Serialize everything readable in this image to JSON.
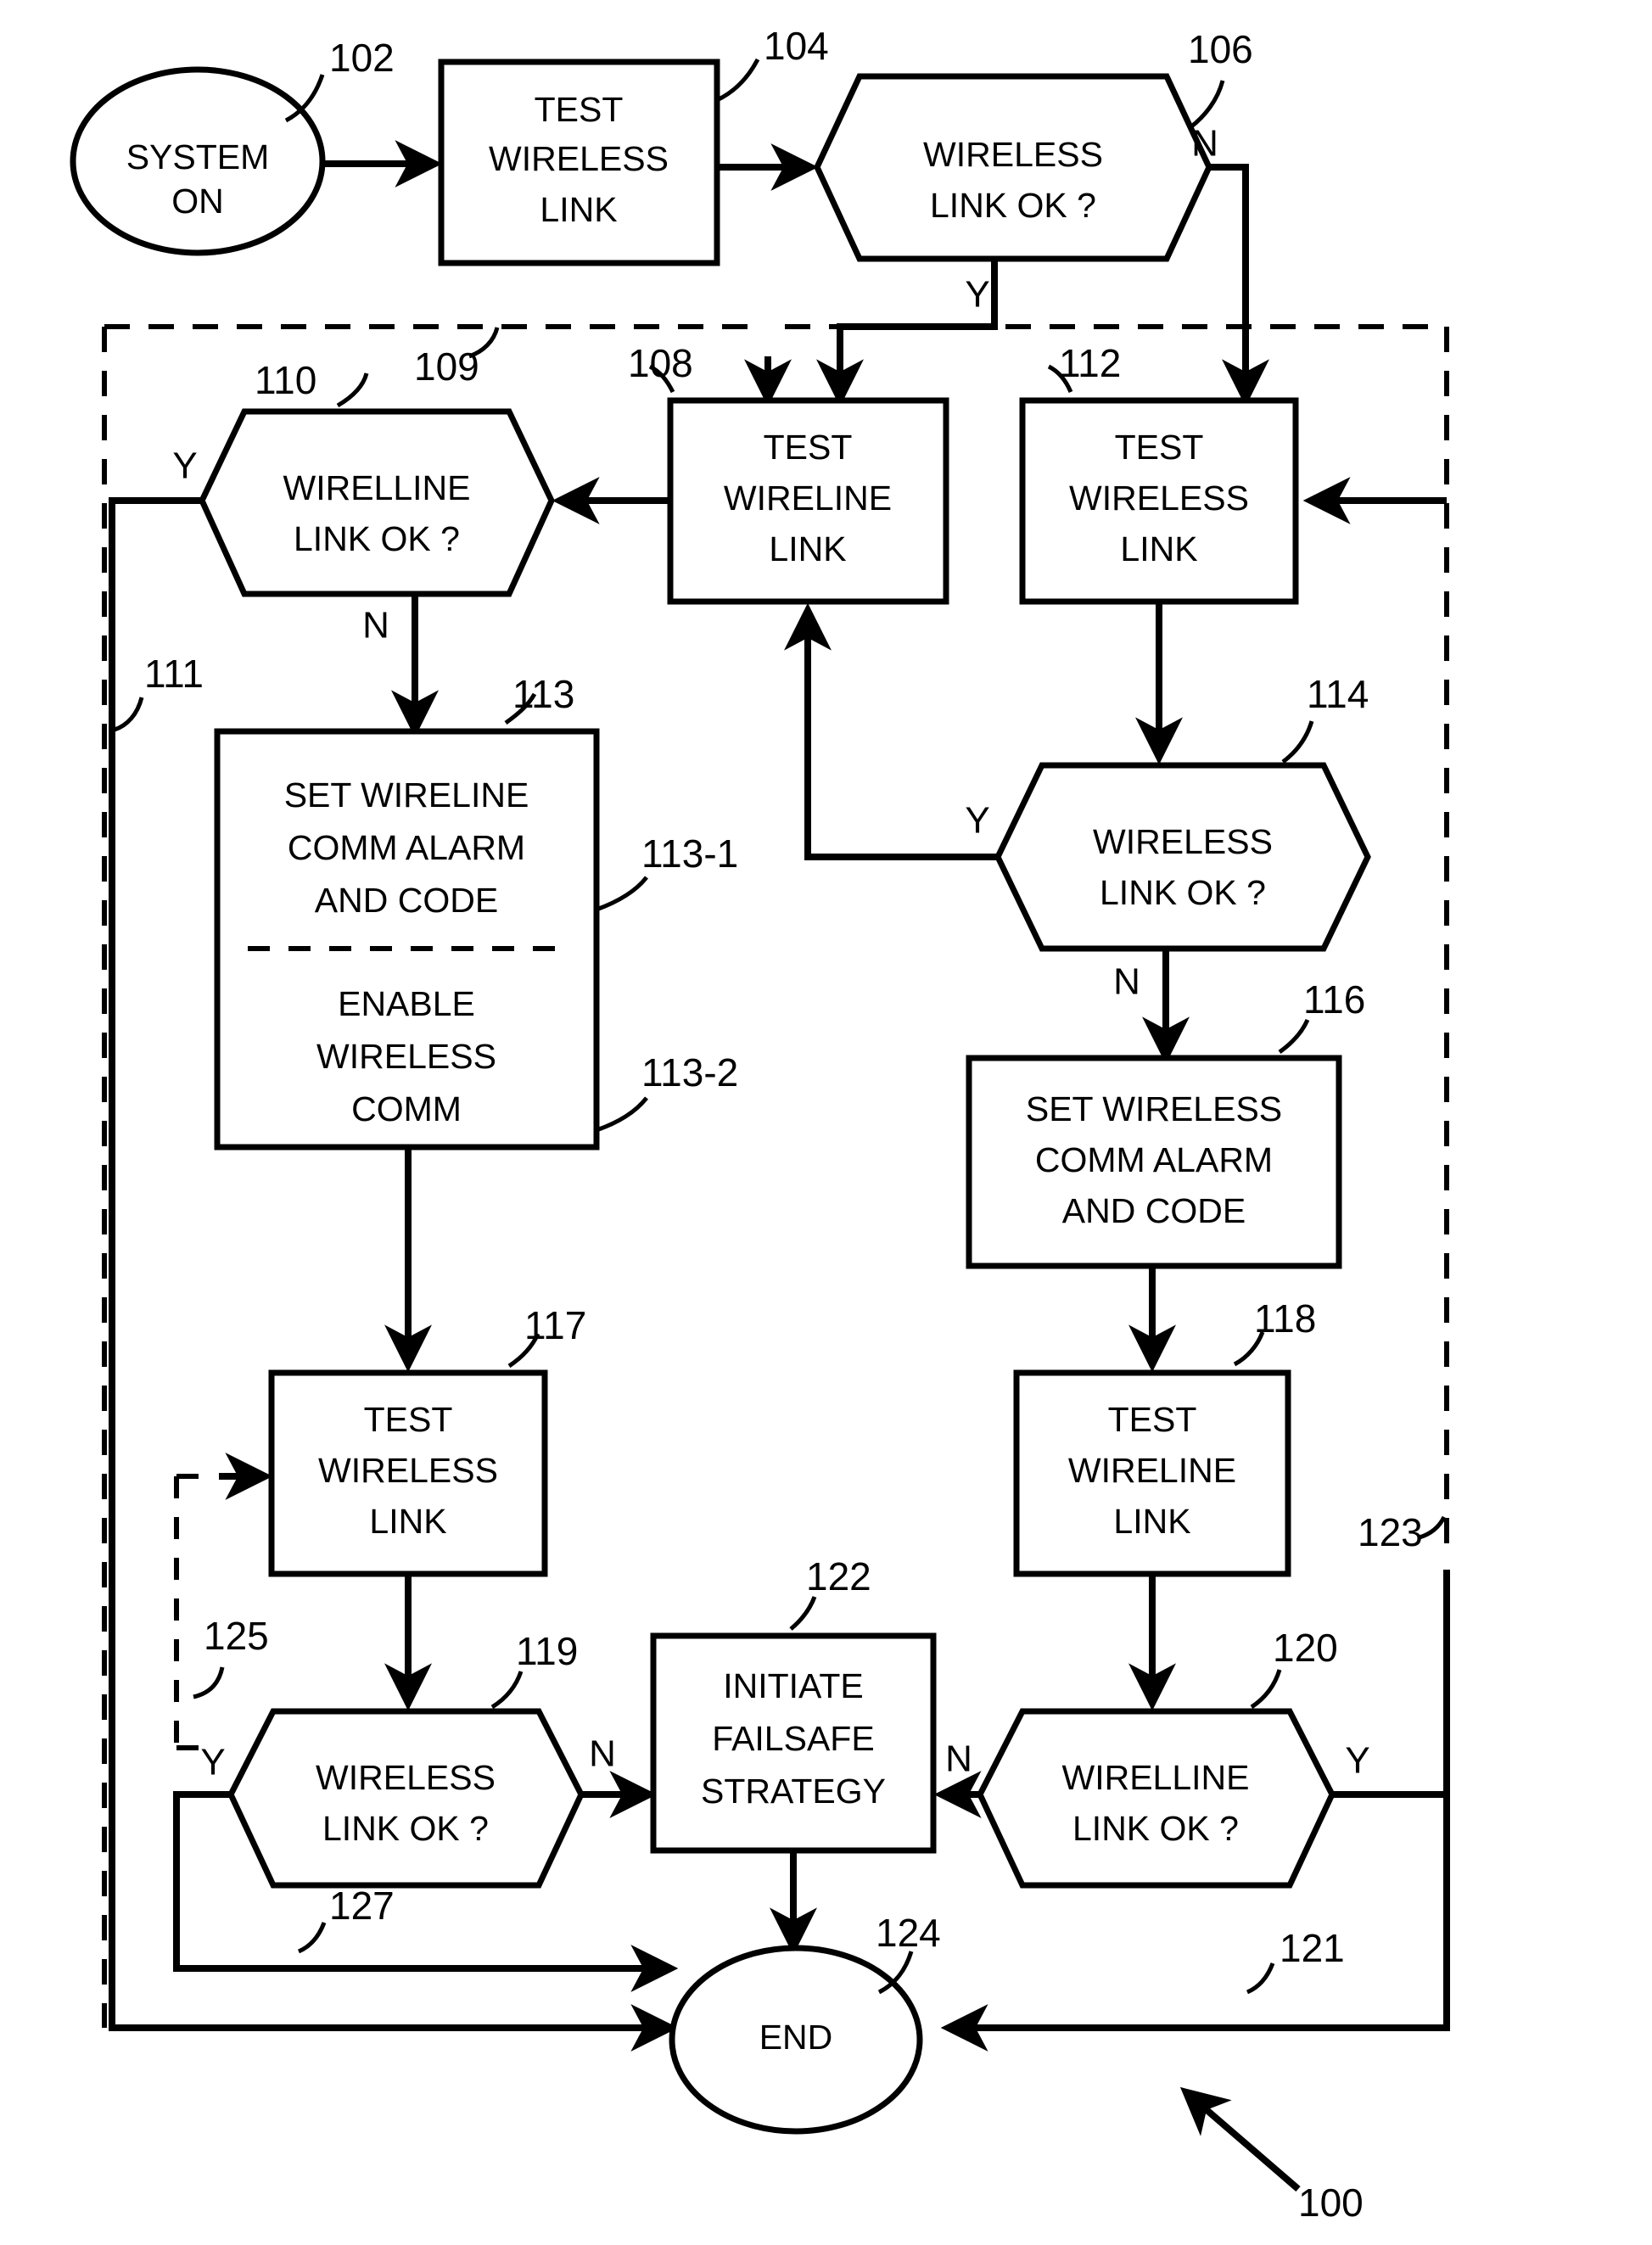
{
  "figure": {
    "type": "patent-flowchart",
    "figure_ref": "100",
    "background_color": "#ffffff",
    "line_color": "#000000"
  },
  "nodes": {
    "start": {
      "ref": "102",
      "label_line1": "SYSTEM",
      "label_line2": "ON",
      "shape": "ellipse"
    },
    "n104": {
      "ref": "104",
      "label_line1": "TEST",
      "label_line2": "WIRELESS",
      "label_line3": "LINK",
      "shape": "rect"
    },
    "n106": {
      "ref": "106",
      "label_line1": "WIRELESS",
      "label_line2": "LINK OK  ?",
      "shape": "hexagon"
    },
    "n108": {
      "ref": "108",
      "label_line1": "TEST",
      "label_line2": "WIRELINE",
      "label_line3": "LINK",
      "shape": "rect"
    },
    "n110": {
      "ref": "110",
      "label_line1": "WIRELLINE",
      "label_line2": "LINK OK  ?",
      "shape": "hexagon"
    },
    "n112": {
      "ref": "112",
      "label_line1": "TEST",
      "label_line2": "WIRELESS",
      "label_line3": "LINK",
      "shape": "rect"
    },
    "n113": {
      "ref": "113",
      "sub1_ref": "113-1",
      "sub2_ref": "113-2",
      "sub1_line1": "SET WIRELINE",
      "sub1_line2": "COMM ALARM",
      "sub1_line3": "AND CODE",
      "sub2_line1": "ENABLE",
      "sub2_line2": "WIRELESS",
      "sub2_line3": "COMM",
      "shape": "rect-split"
    },
    "n114": {
      "ref": "114",
      "label_line1": "WIRELESS",
      "label_line2": "LINK OK  ?",
      "shape": "hexagon"
    },
    "n116": {
      "ref": "116",
      "label_line1": "SET WIRELESS",
      "label_line2": "COMM ALARM",
      "label_line3": "AND CODE",
      "shape": "rect"
    },
    "n117": {
      "ref": "117",
      "label_line1": "TEST",
      "label_line2": "WIRELESS",
      "label_line3": "LINK",
      "shape": "rect"
    },
    "n118": {
      "ref": "118",
      "label_line1": "TEST",
      "label_line2": "WIRELINE",
      "label_line3": "LINK",
      "shape": "rect"
    },
    "n119": {
      "ref": "119",
      "label_line1": "WIRELESS",
      "label_line2": "LINK OK  ?",
      "shape": "hexagon"
    },
    "n120": {
      "ref": "120",
      "label_line1": "WIRELLINE",
      "label_line2": "LINK OK  ?",
      "shape": "hexagon"
    },
    "n122": {
      "ref": "122",
      "label_line1": "INITIATE",
      "label_line2": "FAILSAFE",
      "label_line3": "STRATEGY",
      "shape": "rect"
    },
    "n124": {
      "ref": "124",
      "label": "END",
      "shape": "ellipse"
    }
  },
  "branch_labels": {
    "b106_n": "N",
    "b106_y": "Y",
    "b110_y": "Y",
    "b110_n": "N",
    "b114_y": "Y",
    "b114_n": "N",
    "b119_y": "Y",
    "b119_n": "N",
    "b120_n": "N",
    "b120_y": "Y"
  },
  "connector_refs": {
    "r109": "109",
    "r111": "111",
    "r121": "121",
    "r123": "123",
    "r125": "125",
    "r127": "127",
    "r100": "100"
  }
}
